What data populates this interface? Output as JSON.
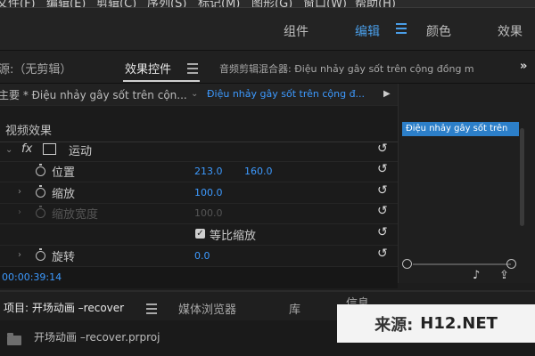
{
  "menubar": {
    "items": [
      "文件(F)",
      "编辑(E)",
      "剪辑(C)",
      "序列(S)",
      "标记(M)",
      "图形(G)",
      "窗口(W)",
      "帮助(H)"
    ]
  },
  "workspaces": {
    "items": [
      "组件",
      "编辑",
      "颜色",
      "效果"
    ],
    "active": "编辑"
  },
  "panel_tabs": {
    "source": "源:（无剪辑）",
    "effect_controls": "效果控件",
    "audio_mixer": "音频剪辑混合器: Điệu nhảy gây sốt trên cộng đồng m",
    "overflow": "»"
  },
  "clip_selector": {
    "master_label": "主要 * Điệu nhảy gây sốt trên cộn...",
    "sequence_label": "Điệu nhảy gây sốt trên cộng đ...",
    "play_icon": "▶"
  },
  "effects": {
    "section": "视频效果",
    "motion_label": "运动",
    "position_label": "位置",
    "position_x": "213.0",
    "position_y": "160.0",
    "scale_label": "缩放",
    "scale_value": "100.0",
    "scale_width_label": "缩放宽度",
    "scale_width_value": "100.0",
    "uniform_label": "等比缩放",
    "rotation_label": "旋转",
    "rotation_value": "0.0"
  },
  "timeline_preview": {
    "clip_label": "Điệu nhảy gây sốt trên"
  },
  "timecode": "00:00:39:14",
  "project_tabs": {
    "project": "项目: 开场动画 –recover",
    "media_browser": "媒体浏览器",
    "library": "库",
    "info": "信息"
  },
  "project_items": [
    {
      "name": "开场动画 –recover.prproj"
    }
  ],
  "watermark": {
    "source": "来源:",
    "site": "H12.NET"
  },
  "icons": {
    "reset": "↺",
    "fx": "fx",
    "hamburger": "≡",
    "audio": "♪",
    "export": "⇪"
  }
}
